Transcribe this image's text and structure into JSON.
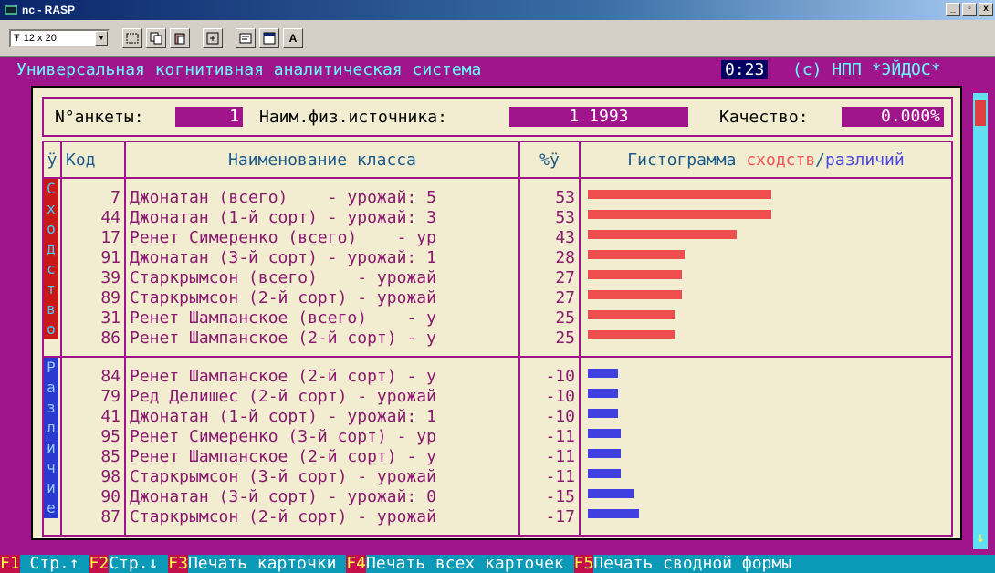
{
  "window": {
    "title": "nc - RASP",
    "min": "_",
    "max": "▫",
    "close": "x"
  },
  "toolbar": {
    "font_size": "12 x 20",
    "font_prefix": "Ŧ",
    "a_button": "A"
  },
  "header": {
    "title": "Универсальная когнитивная аналитическая система",
    "time": "0:23",
    "copyright": "(c) НПП *ЭЙДОС*"
  },
  "anketa": {
    "num_label": "N°анкеты:",
    "num_value": "1",
    "source_label": "Наим.физ.источника:",
    "source_value": "1 1993",
    "quality_label": "Качество:",
    "quality_value": "0.000%"
  },
  "columns": {
    "check": "ÿ",
    "code": "Код",
    "name": "Наименование класса",
    "pct": "%ÿ",
    "hist_prefix": "Гистограмма ",
    "hist_sim": "сходств",
    "hist_slash": "/",
    "hist_dif": "различий"
  },
  "similarity": {
    "side_letters": [
      "С",
      "х",
      "о",
      "д",
      "с",
      "т",
      "в",
      "о"
    ],
    "rows": [
      {
        "code": "7",
        "name": "Джонатан (всего)    - урожай: 5",
        "pct": "53"
      },
      {
        "code": "44",
        "name": "Джонатан (1-й сорт) - урожай: 3",
        "pct": "53"
      },
      {
        "code": "17",
        "name": "Ренет Симеренко (всего)    - ур",
        "pct": "43"
      },
      {
        "code": "91",
        "name": "Джонатан (3-й сорт) - урожай: 1",
        "pct": "28"
      },
      {
        "code": "39",
        "name": "Старкрымсон (всего)    - урожай",
        "pct": "27"
      },
      {
        "code": "89",
        "name": "Старкрымсон (2-й сорт) - урожай",
        "pct": "27"
      },
      {
        "code": "31",
        "name": "Ренет Шампанское (всего)    - у",
        "pct": "25"
      },
      {
        "code": "86",
        "name": "Ренет Шампанское (2-й сорт) - у",
        "pct": "25"
      }
    ]
  },
  "difference": {
    "side_letters": [
      "Р",
      "а",
      "з",
      "л",
      "и",
      "ч",
      "и",
      "е"
    ],
    "rows": [
      {
        "code": "84",
        "name": "Ренет Шампанское (2-й сорт) - у",
        "pct": "-10"
      },
      {
        "code": "79",
        "name": "Ред Делишес (2-й сорт) - урожай",
        "pct": "-10"
      },
      {
        "code": "41",
        "name": "Джонатан (1-й сорт) - урожай: 1",
        "pct": "-10"
      },
      {
        "code": "95",
        "name": "Ренет Симеренко (3-й сорт) - ур",
        "pct": "-11"
      },
      {
        "code": "85",
        "name": "Ренет Шампанское (2-й сорт) - у",
        "pct": "-11"
      },
      {
        "code": "98",
        "name": "Старкрымсон (3-й сорт) - урожай",
        "pct": "-11"
      },
      {
        "code": "90",
        "name": "Джонатан (3-й сорт) - урожай: 0",
        "pct": "-15"
      },
      {
        "code": "87",
        "name": "Старкрымсон (2-й сорт) - урожай",
        "pct": "-17"
      }
    ]
  },
  "scroll_arrow": "↓",
  "fkeys": [
    {
      "key": "F1",
      "label": " Стр.↑ "
    },
    {
      "key": "F2",
      "label": "Стр.↓ "
    },
    {
      "key": "F3",
      "label": "Печать карточки "
    },
    {
      "key": "F4",
      "label": "Печать всех карточек "
    },
    {
      "key": "F5",
      "label": "Печать сводной формы"
    }
  ],
  "colors": {
    "background": "#a0148c",
    "similarity_bar": "#ee4e4e",
    "difference_bar": "#4040e0"
  }
}
